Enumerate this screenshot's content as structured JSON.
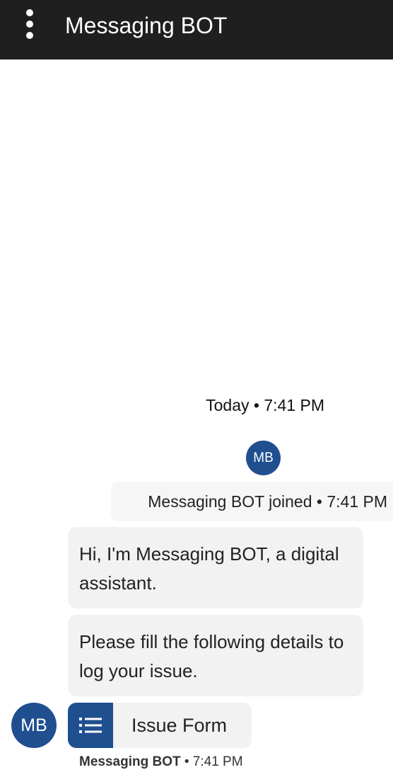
{
  "header": {
    "title": "Messaging BOT",
    "menu_icon": "more-vertical-icon"
  },
  "conversation": {
    "timestamp": "Today • 7:41 PM",
    "bot_initials": "MB",
    "join_notice": "Messaging BOT joined • 7:41 PM",
    "messages": [
      {
        "text": "Hi, I'm Messaging BOT, a digital assistant."
      },
      {
        "text": "Please fill the following details to log your issue."
      }
    ],
    "issue_form": {
      "label": "Issue Form",
      "icon": "list-icon"
    },
    "last_meta": {
      "sender": "Messaging BOT",
      "separator": " • ",
      "time": "7:41 PM"
    }
  },
  "colors": {
    "header_bg": "#1f1f1f",
    "accent": "#1f4f8f",
    "bubble_bg": "#f2f2f2",
    "banner_bg": "#f6f6f6"
  }
}
